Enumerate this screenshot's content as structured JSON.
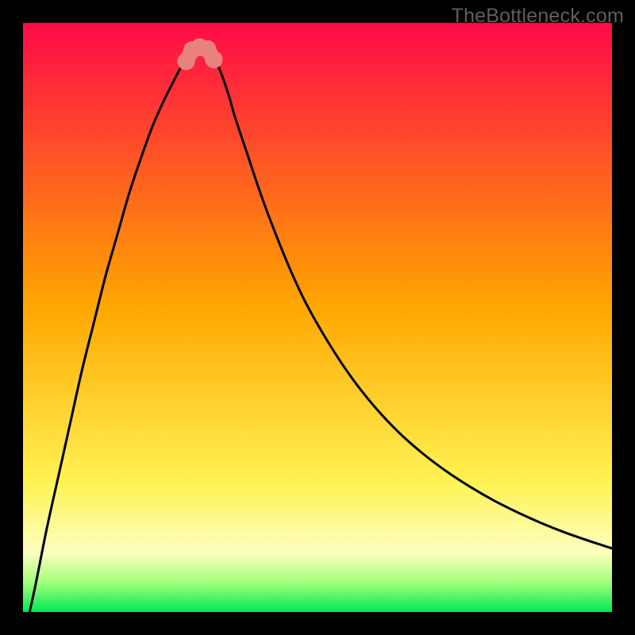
{
  "watermark": "TheBottleneck.com",
  "chart_data": {
    "type": "line",
    "title": "",
    "xlabel": "",
    "ylabel": "",
    "xlim": [
      0,
      100
    ],
    "ylim": [
      0,
      100
    ],
    "grid": false,
    "legend": false,
    "background_gradient": {
      "stops": [
        {
          "pos": 0.0,
          "color": "#ff0a48"
        },
        {
          "pos": 0.48,
          "color": "#ffa600"
        },
        {
          "pos": 0.78,
          "color": "#fff353"
        },
        {
          "pos": 0.9,
          "color": "#fdffc0"
        },
        {
          "pos": 0.95,
          "color": "#a3ff7a"
        },
        {
          "pos": 1.0,
          "color": "#00e85a"
        }
      ]
    },
    "green_band_y": [
      94.5,
      100
    ],
    "series": [
      {
        "name": "bottleneck-curve",
        "x": [
          0,
          2,
          4,
          6,
          8,
          10,
          12,
          14,
          16,
          18,
          20,
          22,
          24,
          25.5,
          27,
          28.5,
          29.5,
          30.2,
          31,
          32,
          33,
          34,
          35,
          36,
          38,
          40,
          42,
          45,
          48,
          52,
          56,
          60,
          64,
          68,
          72,
          76,
          80,
          84,
          88,
          92,
          96,
          100
        ],
        "y": [
          -5,
          4,
          14,
          23,
          32,
          41,
          49,
          57,
          64,
          71,
          77,
          82.5,
          87,
          90,
          92.8,
          94.8,
          95.7,
          96,
          95.8,
          94.8,
          93,
          90.5,
          87.5,
          84,
          78,
          72,
          66.5,
          59,
          52.5,
          45.5,
          39.5,
          34.5,
          30.3,
          26.8,
          23.8,
          21.2,
          18.9,
          16.9,
          15.1,
          13.5,
          12.1,
          10.8
        ]
      }
    ],
    "markers": [
      {
        "x": 27.7,
        "y": 93.5,
        "r": 1.5,
        "color": "#e9817c"
      },
      {
        "x": 28.7,
        "y": 95.4,
        "r": 1.5,
        "color": "#e9817c"
      },
      {
        "x": 30.0,
        "y": 95.9,
        "r": 1.5,
        "color": "#e9817c"
      },
      {
        "x": 31.3,
        "y": 95.6,
        "r": 1.5,
        "color": "#e9817c"
      },
      {
        "x": 32.4,
        "y": 93.8,
        "r": 1.5,
        "color": "#e9817c"
      }
    ],
    "marker_connector": {
      "color": "#e9817c",
      "width_pct": 2.6,
      "points_index": [
        0,
        1,
        2,
        3,
        4
      ]
    }
  }
}
